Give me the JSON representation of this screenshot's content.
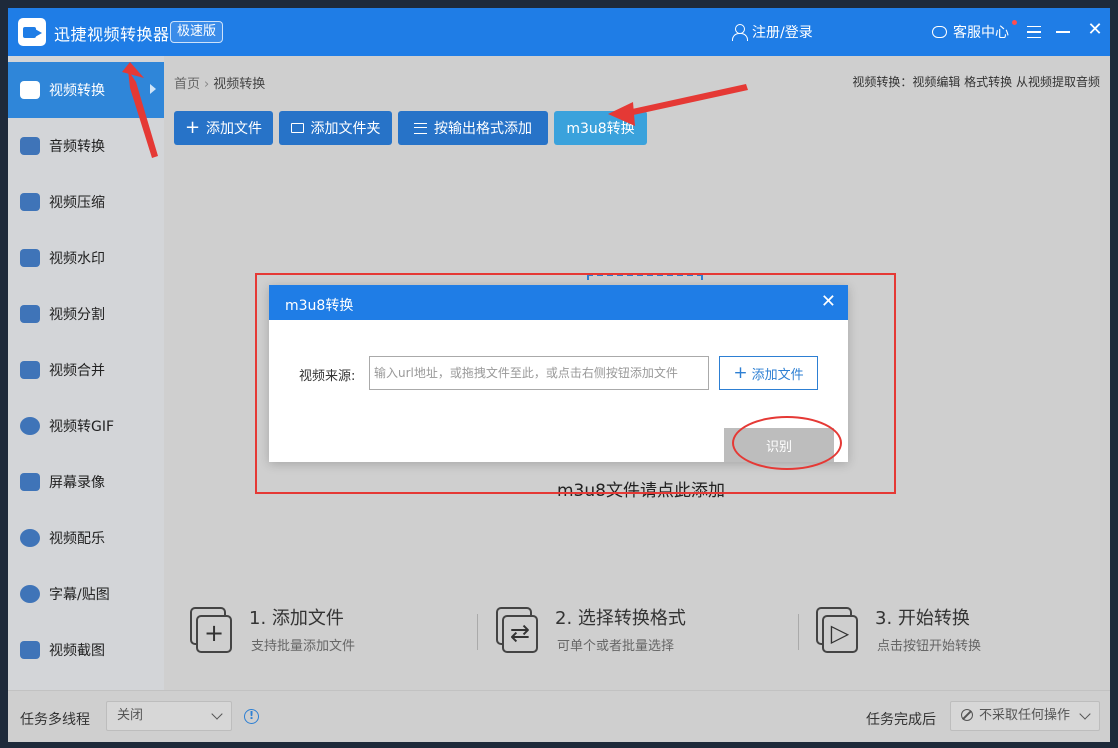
{
  "titlebar": {
    "app_title": "迅捷视频转换器",
    "edition": "极速版",
    "login": "注册/登录",
    "service": "客服中心"
  },
  "sidebar": {
    "items": [
      {
        "label": "视频转换",
        "icon": "video-convert-icon",
        "active": true
      },
      {
        "label": "音频转换",
        "icon": "audio-convert-icon"
      },
      {
        "label": "视频压缩",
        "icon": "video-compress-icon"
      },
      {
        "label": "视频水印",
        "icon": "video-watermark-icon"
      },
      {
        "label": "视频分割",
        "icon": "video-split-icon"
      },
      {
        "label": "视频合并",
        "icon": "video-merge-icon"
      },
      {
        "label": "视频转GIF",
        "icon": "gif-icon"
      },
      {
        "label": "屏幕录像",
        "icon": "screen-record-icon"
      },
      {
        "label": "视频配乐",
        "icon": "music-icon"
      },
      {
        "label": "字幕/贴图",
        "icon": "subtitle-icon"
      },
      {
        "label": "视频截图",
        "icon": "screenshot-icon"
      }
    ]
  },
  "breadcrumb": {
    "home": "首页",
    "current": "视频转换"
  },
  "top_hint": "视频转换：视频编辑 格式转换 从视频提取音频",
  "toolbar": {
    "add_file": "添加文件",
    "add_folder": "添加文件夹",
    "add_by_format": "按输出格式添加",
    "m3u8": "m3u8转换"
  },
  "drop_text": "m3u8文件请点此添加",
  "steps": [
    {
      "title": "1. 添加文件",
      "desc": "支持批量添加文件",
      "icon": "add-file-icon"
    },
    {
      "title": "2. 选择转换格式",
      "desc": "可单个或者批量选择",
      "icon": "swap-format-icon"
    },
    {
      "title": "3. 开始转换",
      "desc": "点击按钮开始转换",
      "icon": "clapper-icon"
    }
  ],
  "footer": {
    "multithread_label": "任务多线程",
    "multithread_value": "关闭",
    "after_label": "任务完成后",
    "after_value": "不采取任何操作"
  },
  "dialog": {
    "title": "m3u8转换",
    "source_label": "视频来源:",
    "input_placeholder": "输入url地址，或拖拽文件至此，或点击右侧按钮添加文件",
    "input_value": "",
    "add_file": "添加文件",
    "identify": "识别"
  },
  "colors": {
    "brand_blue": "#1f7de6",
    "toolbar_blue": "#2773c8",
    "m3u8_button": "#3aa2dc",
    "annotation_red": "#e53935"
  }
}
